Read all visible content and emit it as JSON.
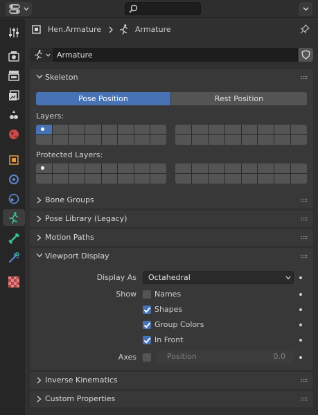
{
  "header": {
    "editor_type_icon": "properties-editor-icon",
    "search_icon": "search-icon",
    "collapse_icon": "chevron-down-icon"
  },
  "breadcrumb": {
    "object_name": "Hen.Armature",
    "data_name": "Armature",
    "pin_icon": "pin-icon"
  },
  "datablock": {
    "value": "Armature",
    "shield_icon": "fake-user-shield-icon"
  },
  "tabs": [
    {
      "name": "tool",
      "icon": "tool-icon"
    },
    {
      "name": "render",
      "icon": "render-icon"
    },
    {
      "name": "output",
      "icon": "output-icon"
    },
    {
      "name": "view-layer",
      "icon": "view-layer-icon"
    },
    {
      "name": "scene",
      "icon": "scene-icon"
    },
    {
      "name": "world",
      "icon": "world-icon"
    },
    {
      "name": "object",
      "icon": "object-icon"
    },
    {
      "name": "modifiers",
      "icon": "modifiers-icon"
    },
    {
      "name": "physics",
      "icon": "physics-icon"
    },
    {
      "name": "object-data",
      "icon": "armature-data-icon",
      "active": true
    },
    {
      "name": "bone",
      "icon": "bone-icon"
    },
    {
      "name": "bone-constraints",
      "icon": "bone-constraint-icon"
    },
    {
      "name": "texture",
      "icon": "texture-icon"
    }
  ],
  "skeleton": {
    "title": "Skeleton",
    "pose_position": "Pose Position",
    "rest_position": "Rest Position",
    "selected": "Pose Position",
    "layers_label": "Layers:",
    "protected_layers_label": "Protected Layers:",
    "active_layer": 1,
    "protected_marked_layer": 1
  },
  "collapsed_panels": {
    "bone_groups": "Bone Groups",
    "pose_library": "Pose Library (Legacy)",
    "motion_paths": "Motion Paths",
    "inverse_kinematics": "Inverse Kinematics",
    "custom_properties": "Custom Properties"
  },
  "viewport_display": {
    "title": "Viewport Display",
    "display_as_label": "Display As",
    "display_as_value": "Octahedral",
    "show_label": "Show",
    "names_label": "Names",
    "names_checked": false,
    "shapes_label": "Shapes",
    "shapes_checked": true,
    "group_colors_label": "Group Colors",
    "group_colors_checked": true,
    "in_front_label": "In Front",
    "in_front_checked": true,
    "axes_label": "Axes",
    "axes_checked": false,
    "position_label": "Position",
    "position_value": "0.0"
  },
  "colors": {
    "accent": "#4772b3",
    "armature_tab": "#3cbf9c"
  }
}
